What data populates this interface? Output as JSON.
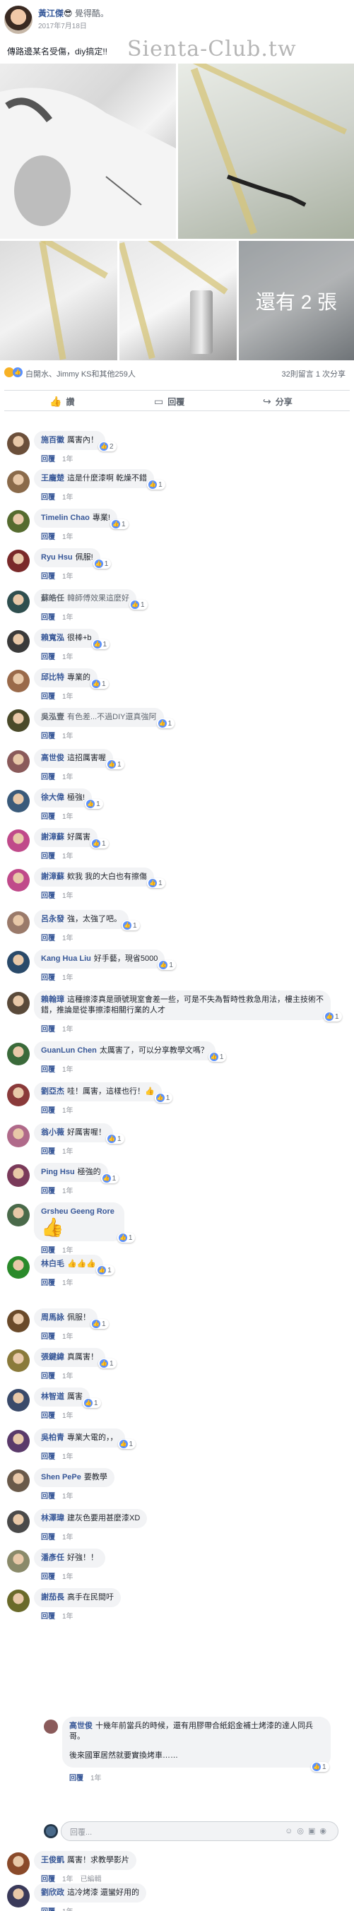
{
  "post": {
    "author": "黃江傑",
    "emoji": "😎",
    "feeling": "覺得酷。",
    "date": "2017年7月18日",
    "text": "傳路邊某名受傷，diy搞定!!",
    "watermark": "Sienta-Club.tw",
    "more_photos": "還有 2 張",
    "reaction_names": "白開水、Jimmy KS和其他259人",
    "counts": "32則留言  1 次分享"
  },
  "actions": {
    "like": "讚",
    "comment": "回覆",
    "share": "分享"
  },
  "reply": "回覆",
  "age": "1年",
  "edited": "已編輯",
  "comments": [
    {
      "name": "施百徽",
      "text": "厲害內！",
      "likes": "2",
      "color": "#6b4f3a"
    },
    {
      "name": "王龐楚",
      "text": "這是什麼漆啊 乾燥不錯",
      "likes": "1",
      "color": "#8a6a4a"
    },
    {
      "name": "Timelin Chao",
      "text": "專業!",
      "likes": "1",
      "color": "#556b2f"
    },
    {
      "name": "Ryu Hsu",
      "text": "佩服!",
      "likes": "1",
      "color": "#7a2a2a"
    },
    {
      "name": "蘇皓任",
      "text": "韓師傅效果這麼好",
      "likes": "1",
      "color": "#2f4f4f",
      "gray": true
    },
    {
      "name": "賴寬泓",
      "text": "很棒+b",
      "likes": "1",
      "color": "#3a3a3a"
    },
    {
      "name": "邱比特",
      "text": "專業的",
      "likes": "1",
      "color": "#9a6a4a"
    },
    {
      "name": "吳泓壹",
      "text": "有色差...不過DIY還真強阿",
      "likes": "1",
      "color": "#4a4a2a",
      "gray": true
    },
    {
      "name": "高世俊",
      "text": "這招厲害喔",
      "likes": "1",
      "color": "#8a5a5a"
    },
    {
      "name": "徐大偉",
      "text": "極強!",
      "likes": "1",
      "color": "#3a5a7a"
    },
    {
      "name": "謝漳蘇",
      "text": "好厲害",
      "likes": "1",
      "color": "#c04a8a"
    },
    {
      "name": "謝漳蘇",
      "text": "欸我 我的大白也有擦傷",
      "likes": "1",
      "color": "#c04a8a"
    },
    {
      "name": "呂永發",
      "text": "強，太強了吧。",
      "likes": "1",
      "color": "#9a7a6a"
    },
    {
      "name": "Kang Hua Liu",
      "text": "好手藝，現省5000",
      "likes": "1",
      "color": "#2a4a6a"
    },
    {
      "name": "賴翰璋",
      "text": "這種擦漆真是頭號現室會差一些，可是不失為暫時性救急用法，樓主技術不錯，推論是從事擦漆相關行業的人才",
      "likes": "1",
      "color": "#5a4a3a"
    },
    {
      "name": "GuanLun Chen",
      "text": "太厲害了，可以分享教學文嗎？",
      "likes": "1",
      "color": "#3a6a3a"
    },
    {
      "name": "劉亞杰",
      "text": "哇！厲害，這樣也行！👍",
      "likes": "1",
      "color": "#8a3a3a"
    },
    {
      "name": "翁小薇",
      "text": "好厲害喔！",
      "likes": "1",
      "color": "#b06a8a"
    },
    {
      "name": "Ping Hsu",
      "text": "極強的",
      "likes": "1",
      "color": "#7a3a5a"
    },
    {
      "name": "Grsheu Geeng Rore",
      "text": "👍",
      "likes": "1",
      "color": "#4a6a4a"
    },
    {
      "name": "林白毛",
      "text": "👍👍👍",
      "likes": "1",
      "color": "#2a8a2a"
    },
    {
      "name": "周馬詠",
      "text": "佩服！",
      "likes": "1",
      "color": "#6a4a2a"
    },
    {
      "name": "張鍵緯",
      "text": "真厲害！",
      "likes": "1",
      "color": "#8a7a3a"
    },
    {
      "name": "林智道",
      "text": "厲害",
      "likes": "1",
      "color": "#3a4a6a"
    },
    {
      "name": "吳柏青",
      "text": "專業大電的，，",
      "likes": "1",
      "color": "#5a3a6a"
    },
    {
      "name": "Shen PePe",
      "text": "要教學",
      "likes": "",
      "color": "#6a5a4a"
    },
    {
      "name": "林澤瑋",
      "text": "建灰色要用甚麼漆XD",
      "likes": "",
      "color": "#4a4a4a"
    },
    {
      "name": "潘彥任",
      "text": "好強！！",
      "likes": "",
      "color": "#8a8a6a"
    },
    {
      "name": "謝茄長",
      "text": "高手在民間吁",
      "likes": "",
      "color": "#6a6a2a"
    }
  ],
  "sub_reply": {
    "name": "高世俊",
    "text": "十幾年前當兵的時候，還有用膠帶合紙鋁金補土烤漆的達人同兵哥。",
    "text2": "後來國軍居然就要實換烤車……",
    "likes": "1"
  },
  "reply_box": {
    "placeholder": "回覆..."
  },
  "tail_comments": [
    {
      "name": "王俊凱",
      "text": "厲害！求教學影片",
      "likes": "",
      "color": "#8a4a2a",
      "edited": true
    },
    {
      "name": "劉欣政",
      "text": "這冷烤漆 還蠻好用的",
      "likes": "",
      "color": "#3a3a5a"
    }
  ]
}
